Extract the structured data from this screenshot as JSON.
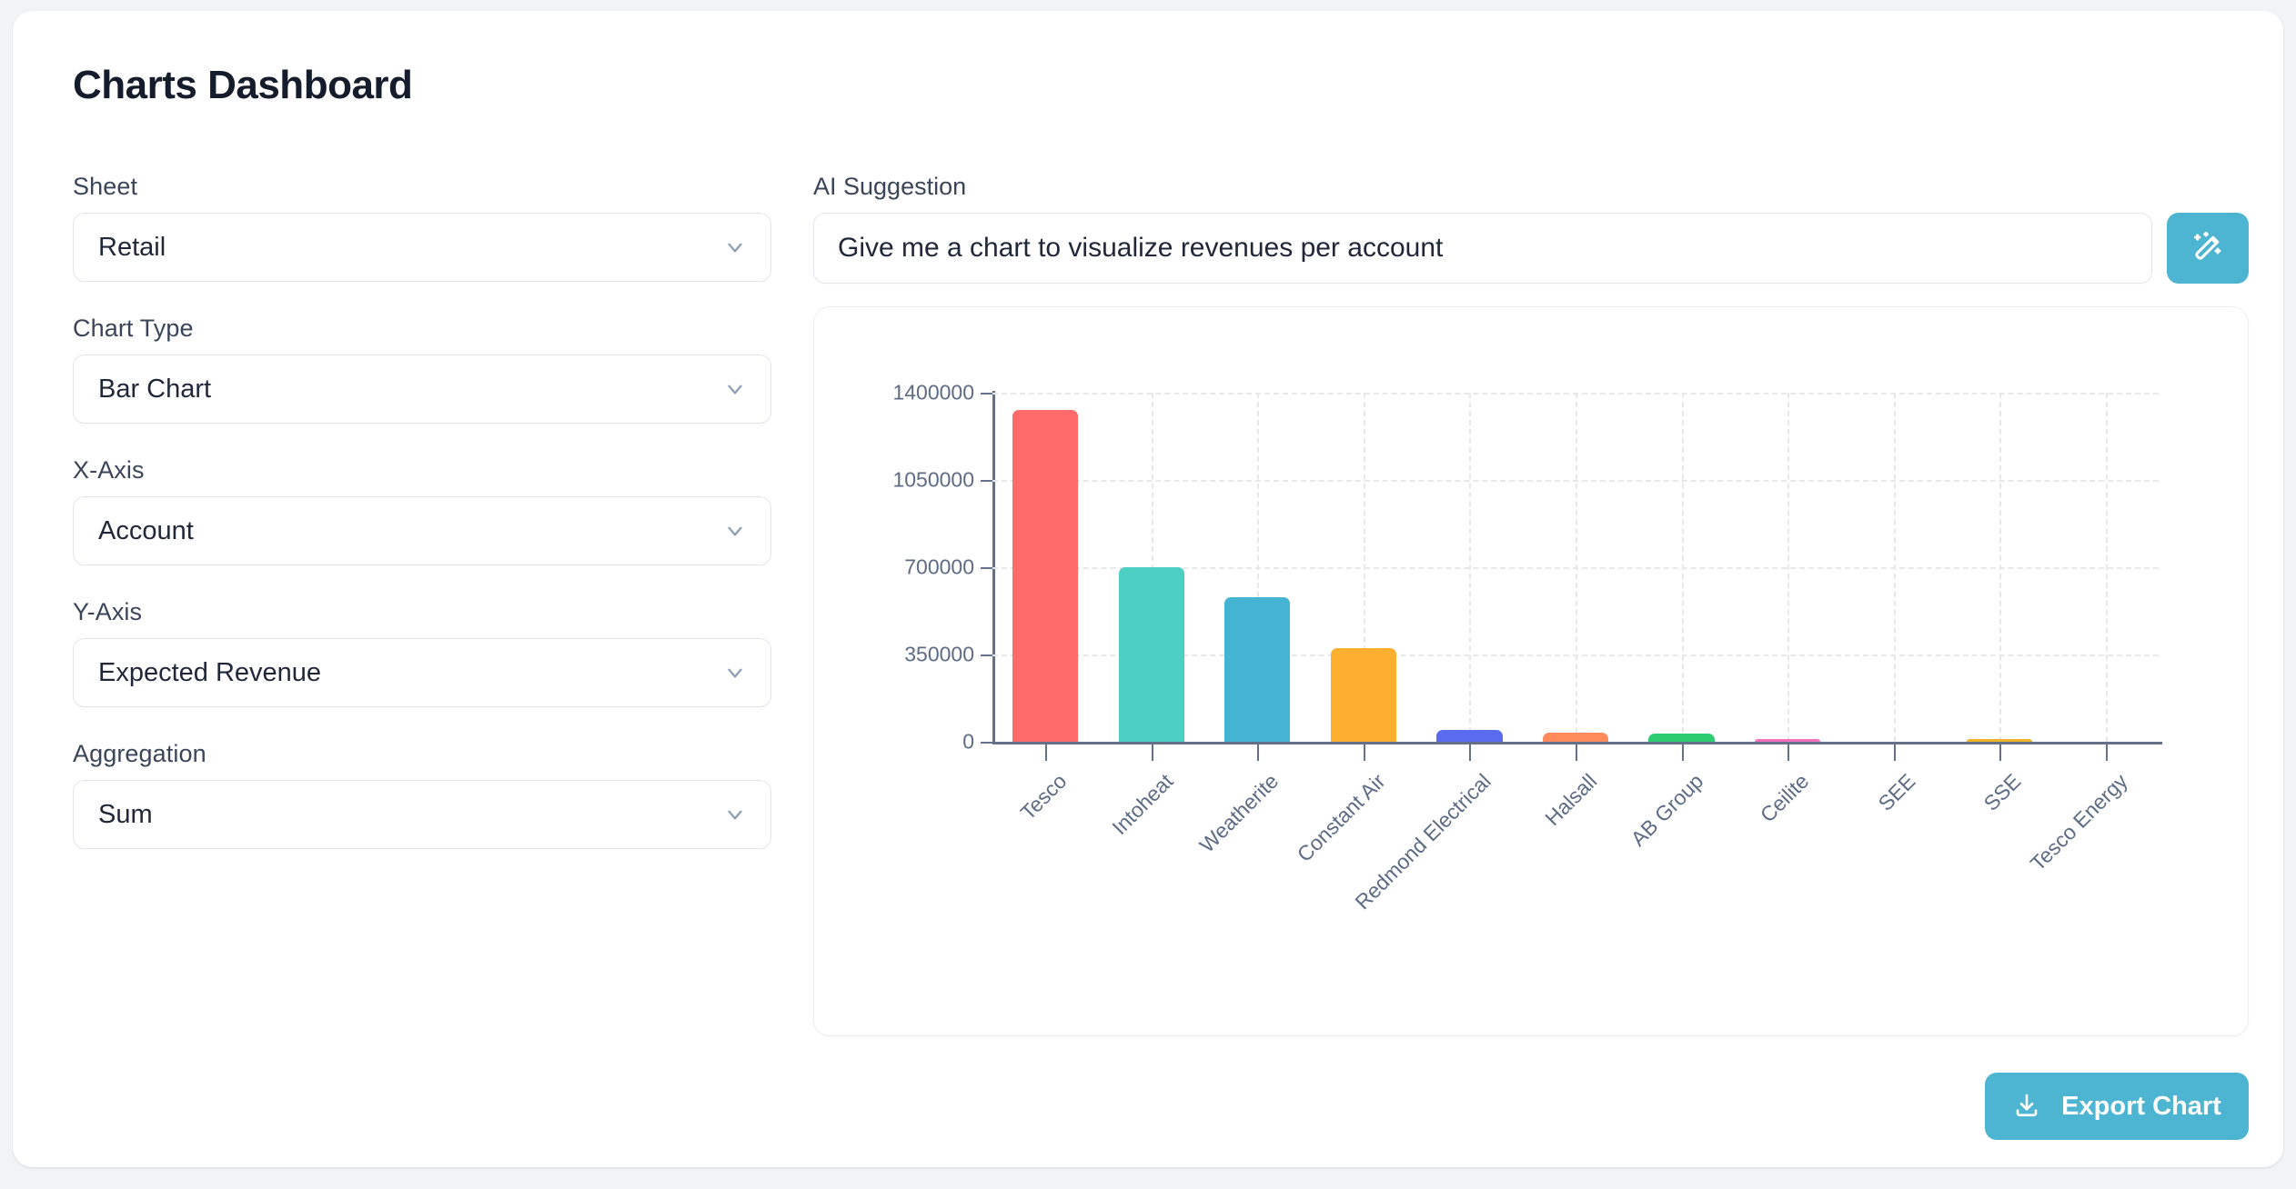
{
  "page": {
    "title": "Charts Dashboard",
    "background_color": "#f1f3f5",
    "card_color": "#ffffff",
    "accent_color": "#4db4d1"
  },
  "controls": [
    {
      "label": "Sheet",
      "value": "Retail",
      "icon": "chevron-down-icon"
    },
    {
      "label": "Chart Type",
      "value": "Bar Chart",
      "icon": "chevron-down-icon"
    },
    {
      "label": "X-Axis",
      "value": "Account",
      "icon": "chevron-down-icon"
    },
    {
      "label": "Y-Axis",
      "value": "Expected Revenue",
      "icon": "chevron-down-icon"
    },
    {
      "label": "Aggregation",
      "value": "Sum",
      "icon": "chevron-down-icon"
    }
  ],
  "ai": {
    "label": "AI Suggestion",
    "value": "Give me a chart to visualize revenues per account",
    "placeholder": "Give me a chart to visualize revenues per account",
    "button_icon": "magic-wand-icon"
  },
  "export": {
    "label": "Export Chart",
    "icon": "download-icon"
  },
  "chart_data": {
    "type": "bar",
    "title": "",
    "xlabel": "",
    "ylabel": "",
    "ylim": [
      0,
      1400000
    ],
    "yticks": [
      0,
      350000,
      700000,
      1050000,
      1400000
    ],
    "ytick_labels": [
      "0",
      "350000",
      "700000",
      "1050000",
      "1400000"
    ],
    "grid": true,
    "legend": false,
    "categories": [
      "Tesco",
      "Intoheat",
      "Weatherite",
      "Constant Air",
      "Redmond Electrical",
      "Halsall",
      "AB Group",
      "Ceilite",
      "SEE",
      "SSE",
      "Tesco Energy"
    ],
    "values": [
      1330000,
      700000,
      580000,
      375000,
      48000,
      38000,
      32000,
      6000,
      0,
      4000,
      0
    ],
    "colors": [
      "#fd6a6a",
      "#4ecfc4",
      "#45b4d2",
      "#ffaf30",
      "#5b6bef",
      "#ff8a5b",
      "#2ecc71",
      "#f571c0",
      "#c9a0dc",
      "#f0b429",
      "#9ad0ec"
    ]
  }
}
